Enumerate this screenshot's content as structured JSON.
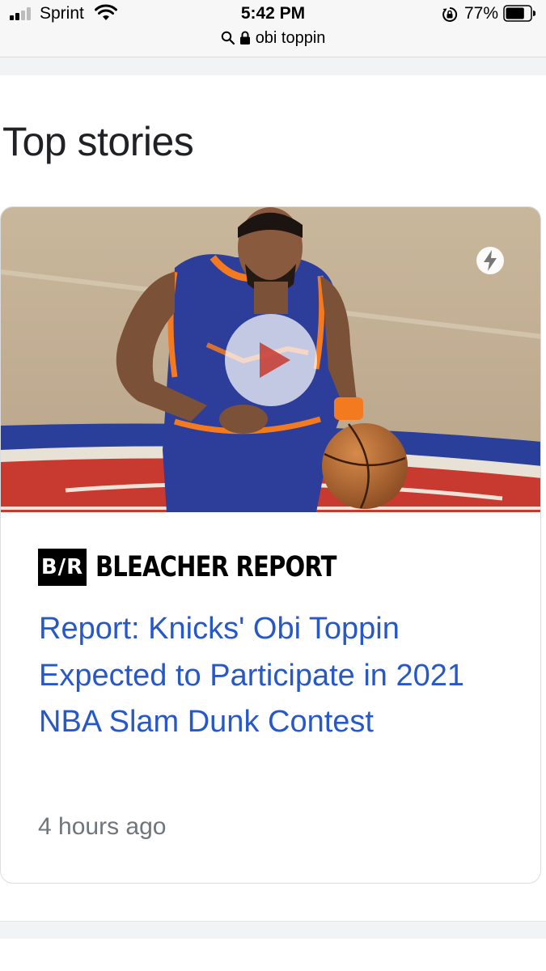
{
  "status_bar": {
    "carrier": "Sprint",
    "time": "5:42 PM",
    "battery_percent": "77%",
    "signal_bars_filled": 2,
    "signal_bars_total": 4,
    "battery_level": 0.77,
    "url": "obi toppin"
  },
  "top_stories": {
    "heading": "Top stories",
    "card": {
      "publisher_logo": "B/R",
      "publisher_name": "BLEACHER REPORT",
      "headline": "Report: Knicks' Obi Toppin Expected to Participate in 2021 NBA Slam Dunk Contest",
      "timestamp": "4 hours ago",
      "has_video": true,
      "amp": true
    }
  },
  "colors": {
    "headline_link": "#2658c9",
    "timestamp": "#70757a",
    "jersey_blue": "#2d3d9a",
    "jersey_orange": "#f47a20"
  },
  "icons": {
    "signal": "cellular-signal-icon",
    "wifi": "wifi-icon",
    "rotation_lock": "rotation-lock-icon",
    "battery": "battery-icon",
    "search": "search-icon",
    "lock": "lock-icon",
    "amp": "lightning-bolt-icon",
    "play": "play-icon"
  }
}
